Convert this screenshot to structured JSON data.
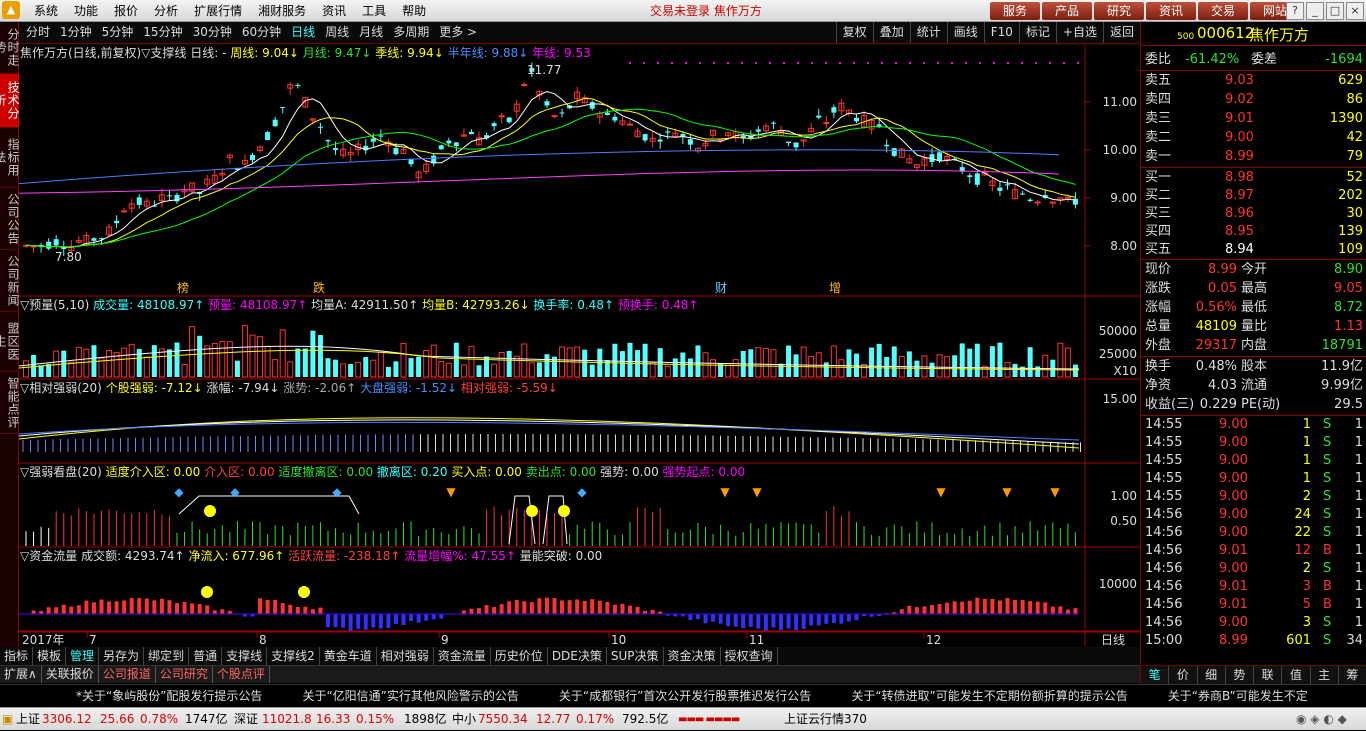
{
  "title": {
    "menu": [
      "系统",
      "功能",
      "报价",
      "分析",
      "扩展行情",
      "湘财服务",
      "资讯",
      "工具",
      "帮助"
    ],
    "status": "交易未登录  焦作万方",
    "buttons": [
      "服务",
      "产品",
      "研究",
      "资讯",
      "交易",
      "网站"
    ]
  },
  "left_tabs": [
    "分时走势",
    "技术分析",
    "指标用法",
    "公司公告",
    "公司新闻",
    "盟区医生",
    "智能点评"
  ],
  "period_bar": {
    "items": [
      "分时",
      "1分钟",
      "5分钟",
      "15分钟",
      "30分钟",
      "60分钟",
      "日线",
      "周线",
      "月线",
      "多周期",
      "更多 >"
    ],
    "selected": "日线",
    "right": [
      "复权",
      "叠加",
      "统计",
      "画线",
      "F10",
      "标记",
      "+自选",
      "返回"
    ]
  },
  "main_title": {
    "name": "焦作万方(日线,前复权)▽支撑线",
    "day": "日线: -",
    "week": "周线: 9.04↓",
    "month": "月线: 9.47↓",
    "season": "季线: 9.94↓",
    "halfyear": "半年线: 9.88↓",
    "year": "年线: 9.53"
  },
  "price_labels": [
    "11.00",
    "10.00",
    "9.00",
    "8.00"
  ],
  "hi_label": "11.77",
  "lo_label": "7.80",
  "event_tags": [
    "榜",
    "跌",
    "财",
    "增"
  ],
  "vol_title": {
    "name": "▽预量(5,10)",
    "vol": "成交量: 48108.97↑",
    "pre": "预量: 48108.97↑",
    "ma": "均量A: 42911.50↑",
    "mb": "均量B: 42793.26↓",
    "turn": "换手率: 0.48↑",
    "pturn": "预换手: 0.48↑"
  },
  "vol_labels": [
    "50000",
    "25000",
    "X10"
  ],
  "rs_title": {
    "name": "▽相对强弱(20)",
    "a": "个股强弱: -7.12↓",
    "b": "涨幅: -7.94↓",
    "c": "涨势: -2.06↑",
    "d": "大盘强弱: -1.52↓",
    "e": "相对强弱: -5.59↓"
  },
  "rs_labels": [
    "15.00"
  ],
  "qr_title": {
    "name": "▽强弱看盘(20)",
    "a": "适度介入区: 0.00",
    "b": "介入区: 0.00",
    "c": "适度撤离区: 0.00",
    "d": "撤离区: 0.20",
    "e": "买入点: 0.00",
    "f": "卖出点: 0.00",
    "g": "强势: 0.00",
    "h": "强势起点: 0.00"
  },
  "qr_labels": [
    "1.00",
    "0.50"
  ],
  "flow_title": {
    "name": "▽资金流量",
    "a": "成交额: 4293.74↑",
    "b": "净流入: 677.96↑",
    "c": "活跃流量: -238.18↑",
    "d": "流量增幅%: 47.55↑",
    "e": "量能突破: 0.00"
  },
  "flow_labels": [
    "10000"
  ],
  "date_axis": {
    "year": "2017年",
    "months": [
      "7",
      "8",
      "9",
      "10",
      "11",
      "12"
    ],
    "period": "日线"
  },
  "bottom_tabs": [
    "指标",
    "模板",
    "管理",
    "另存为",
    "绑定到",
    "普通",
    "支撑线",
    "支撑线2",
    "黄金车道",
    "相对强弱",
    "资金流量",
    "历史价位",
    "DDE决策",
    "SUP决策",
    "资金决策",
    "授权查询"
  ],
  "bottom_selected": "管理",
  "strip2": [
    "扩展∧",
    "关联报价",
    "公司报道",
    "公司研究",
    "个股点评"
  ],
  "quote": {
    "code": "000612",
    "name": "焦作万方",
    "market": "500",
    "wb": {
      "label": "委比",
      "value": "-61.42%",
      "label2": "委差",
      "value2": "-1694"
    },
    "asks": [
      {
        "label": "卖五",
        "price": "9.03",
        "vol": "629"
      },
      {
        "label": "卖四",
        "price": "9.02",
        "vol": "86"
      },
      {
        "label": "卖三",
        "price": "9.01",
        "vol": "1390"
      },
      {
        "label": "卖二",
        "price": "9.00",
        "vol": "42"
      },
      {
        "label": "卖一",
        "price": "8.99",
        "vol": "79"
      }
    ],
    "bids": [
      {
        "label": "买一",
        "price": "8.98",
        "vol": "52"
      },
      {
        "label": "买二",
        "price": "8.97",
        "vol": "202"
      },
      {
        "label": "买三",
        "price": "8.96",
        "vol": "30"
      },
      {
        "label": "买四",
        "price": "8.95",
        "vol": "139"
      },
      {
        "label": "买五",
        "price": "8.94",
        "vol": "109"
      }
    ],
    "stats1": [
      {
        "l": "现价",
        "v": "8.99",
        "l2": "今开",
        "v2": "8.90"
      },
      {
        "l": "涨跌",
        "v": "0.05",
        "l2": "最高",
        "v2": "9.05"
      },
      {
        "l": "涨幅",
        "v": "0.56%",
        "l2": "最低",
        "v2": "8.72"
      },
      {
        "l": "总量",
        "v": "48109",
        "l2": "量比",
        "v2": "1.13"
      },
      {
        "l": "外盘",
        "v": "29317",
        "l2": "内盘",
        "v2": "18791"
      }
    ],
    "stats2": [
      {
        "l": "换手",
        "v": "0.48%",
        "l2": "股本",
        "v2": "11.9亿"
      },
      {
        "l": "净资",
        "v": "4.03",
        "l2": "流通",
        "v2": "9.99亿"
      },
      {
        "l": "收益(三)",
        "v": "0.229",
        "l2": "PE(动)",
        "v2": "29.5"
      }
    ],
    "ticks": [
      {
        "t": "14:55",
        "p": "9.00",
        "v": "1",
        "s": "S",
        "n": "1"
      },
      {
        "t": "14:55",
        "p": "9.00",
        "v": "1",
        "s": "S",
        "n": "1"
      },
      {
        "t": "14:55",
        "p": "9.00",
        "v": "1",
        "s": "S",
        "n": "1"
      },
      {
        "t": "14:55",
        "p": "9.00",
        "v": "1",
        "s": "S",
        "n": "1"
      },
      {
        "t": "14:55",
        "p": "9.00",
        "v": "2",
        "s": "S",
        "n": "1"
      },
      {
        "t": "14:56",
        "p": "9.00",
        "v": "24",
        "s": "S",
        "n": "1"
      },
      {
        "t": "14:56",
        "p": "9.00",
        "v": "22",
        "s": "S",
        "n": "1"
      },
      {
        "t": "14:56",
        "p": "9.01",
        "v": "12",
        "s": "B",
        "n": "1"
      },
      {
        "t": "14:56",
        "p": "9.00",
        "v": "2",
        "s": "S",
        "n": "1"
      },
      {
        "t": "14:56",
        "p": "9.01",
        "v": "3",
        "s": "B",
        "n": "1"
      },
      {
        "t": "14:56",
        "p": "9.01",
        "v": "5",
        "s": "B",
        "n": "1"
      },
      {
        "t": "14:56",
        "p": "9.00",
        "v": "3",
        "s": "S",
        "n": "1"
      },
      {
        "t": "15:00",
        "p": "8.99",
        "v": "601",
        "s": "S",
        "n": "34"
      }
    ],
    "tabs": [
      "笔",
      "价",
      "细",
      "势",
      "联",
      "值",
      "主",
      "筹"
    ]
  },
  "ticker": [
    "*关于“象屿股份”配股发行提示公告",
    "关于“亿阳信通”实行其他风险警示的公告",
    "关于“成都银行”首次公开发行股票推迟发行公告",
    "关于“转债进取”可能发生不定期份额折算的提示公告",
    "关于“券商B”可能发生不定"
  ],
  "statusbar": {
    "sh": {
      "name": "上证",
      "val": "3306.12",
      "chg": "25.66",
      "pct": "0.78%",
      "amt": "1747亿"
    },
    "sz": {
      "name": "深证",
      "val": "11021.8",
      "chg": "16.33",
      "pct": "0.15%",
      "amt": "1898亿"
    },
    "zx": {
      "name": "中小",
      "val": "7550.34",
      "chg": "12.77",
      "pct": "0.17%",
      "amt": "792.5亿"
    },
    "server": "上证云行情370"
  },
  "colors": {
    "up": "#ff3232",
    "down": "#54ffff",
    "ma5": "#ffffff",
    "ma10": "#ffff00",
    "ma20": "#00ff00",
    "ma60": "#4a7fff",
    "ma120": "#ff40ff"
  }
}
